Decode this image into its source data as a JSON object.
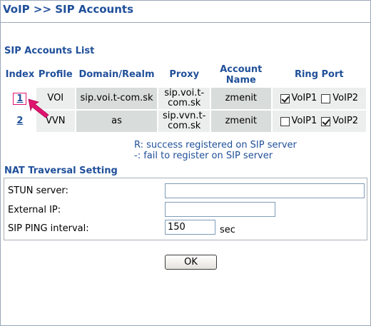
{
  "page": {
    "title": "VoIP >> SIP Accounts"
  },
  "accounts": {
    "section_title": "SIP Accounts List",
    "headers": {
      "index": "Index",
      "profile": "Profile",
      "domain": "Domain/Realm",
      "proxy": "Proxy",
      "account": "Account Name",
      "ring_port": "Ring Port"
    },
    "rows": [
      {
        "index": "1",
        "profile": "VOI",
        "domain": "sip.voi.t-com.sk",
        "proxy": "sip.voi.t-com.sk",
        "account": "zmenit",
        "voip1_label": "VoIP1",
        "voip1_checked": true,
        "voip2_label": "VoIP2",
        "voip2_checked": false
      },
      {
        "index": "2",
        "profile": "VVN",
        "domain": "as",
        "proxy": "sip.vvn.t-com.sk",
        "account": "zmenit",
        "voip1_label": "VoIP1",
        "voip1_checked": false,
        "voip2_label": "VoIP2",
        "voip2_checked": true
      }
    ],
    "legend": [
      "R: success registered on SIP server",
      "-: fail to register on SIP server"
    ]
  },
  "nat": {
    "section_title": "NAT Traversal Setting",
    "stun_label": "STUN server:",
    "stun_value": "",
    "external_ip_label": "External IP:",
    "external_ip_value": "",
    "ping_label": "SIP PING interval:",
    "ping_value": "150",
    "ping_unit": "sec"
  },
  "actions": {
    "ok_label": "OK"
  },
  "colors": {
    "accent": "#20509a",
    "highlight": "#e0136f",
    "row_light": "#eceeed",
    "row_dark": "#d8dcdb"
  },
  "icons": {
    "pointer": "pointer-arrow-icon"
  }
}
